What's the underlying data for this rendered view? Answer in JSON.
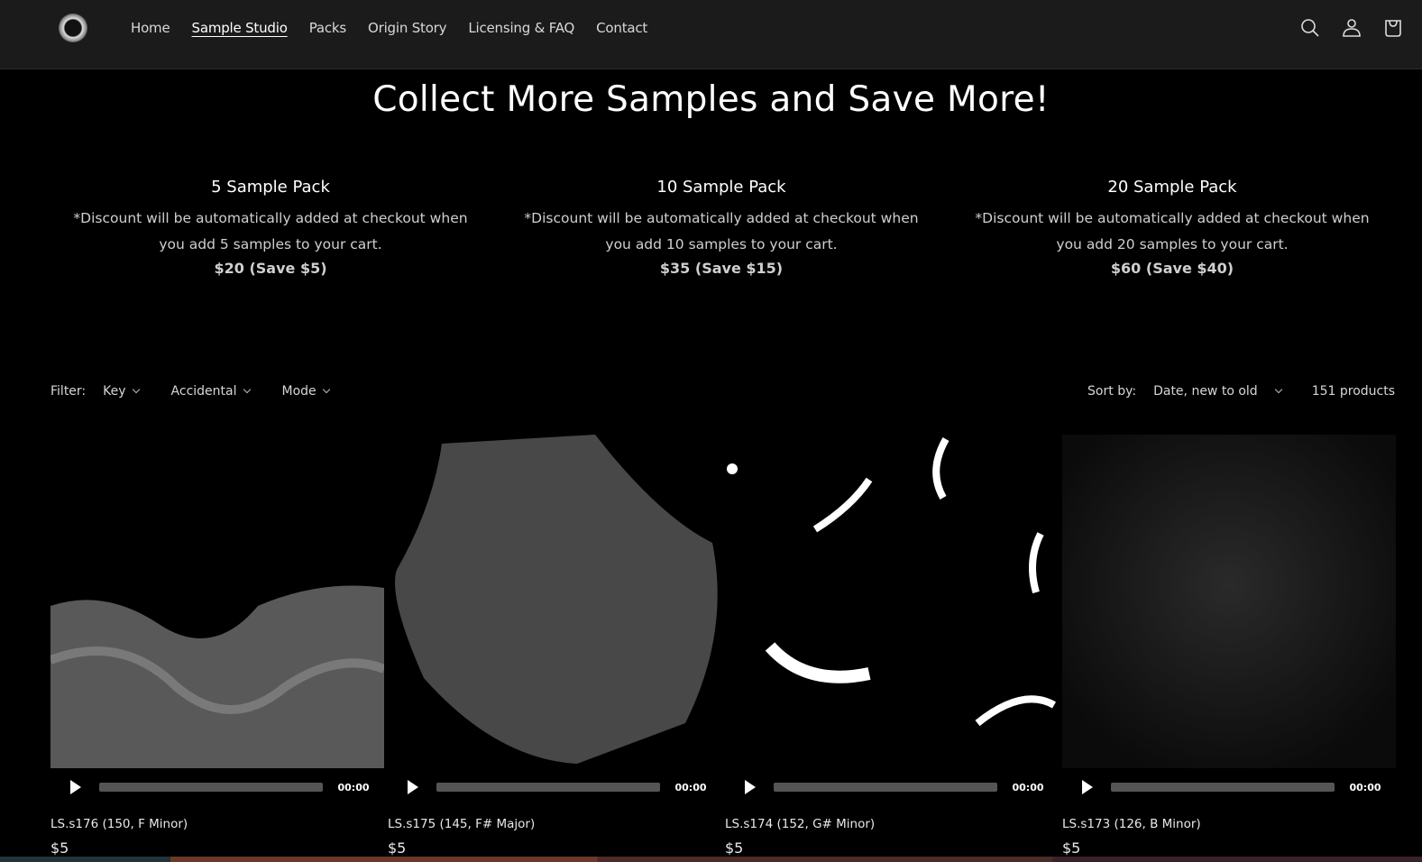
{
  "header": {
    "logo_alt": "site-logo",
    "nav": [
      {
        "label": "Home",
        "active": false
      },
      {
        "label": "Sample Studio",
        "active": true
      },
      {
        "label": "Packs",
        "active": false
      },
      {
        "label": "Origin Story",
        "active": false
      },
      {
        "label": "Licensing & FAQ",
        "active": false
      },
      {
        "label": "Contact",
        "active": false
      }
    ],
    "icons": [
      "search-icon",
      "account-icon",
      "cart-icon"
    ]
  },
  "hero": {
    "title": "Collect More Samples and Save More!"
  },
  "packs": [
    {
      "title": "5 Sample Pack",
      "desc": "*Discount will be automatically added at checkout when you add 5 samples to your cart.",
      "price": "$20 (Save $5)"
    },
    {
      "title": "10 Sample Pack",
      "desc": "*Discount will be automatically added at checkout when you add 10 samples to your cart.",
      "price": "$35 (Save $15)"
    },
    {
      "title": "20 Sample Pack",
      "desc": "*Discount will be automatically added at checkout when you add 20 samples to your cart.",
      "price": "$60 (Save $40)"
    }
  ],
  "filters": {
    "label": "Filter:",
    "options": [
      "Key",
      "Accidental",
      "Mode"
    ],
    "sort_label": "Sort by:",
    "sort_value": "Date, new to old",
    "count": "151 products"
  },
  "products": [
    {
      "title": "LS.s176 (150, F Minor)",
      "price": "$5",
      "time": "00:00",
      "progress": 0
    },
    {
      "title": "LS.s175 (145, F# Major)",
      "price": "$5",
      "time": "00:00",
      "progress": 0
    },
    {
      "title": "LS.s174 (152, G# Minor)",
      "price": "$5",
      "time": "00:00",
      "progress": 0
    },
    {
      "title": "LS.s173 (126, B Minor)",
      "price": "$5",
      "time": "00:00",
      "progress": 0
    }
  ]
}
